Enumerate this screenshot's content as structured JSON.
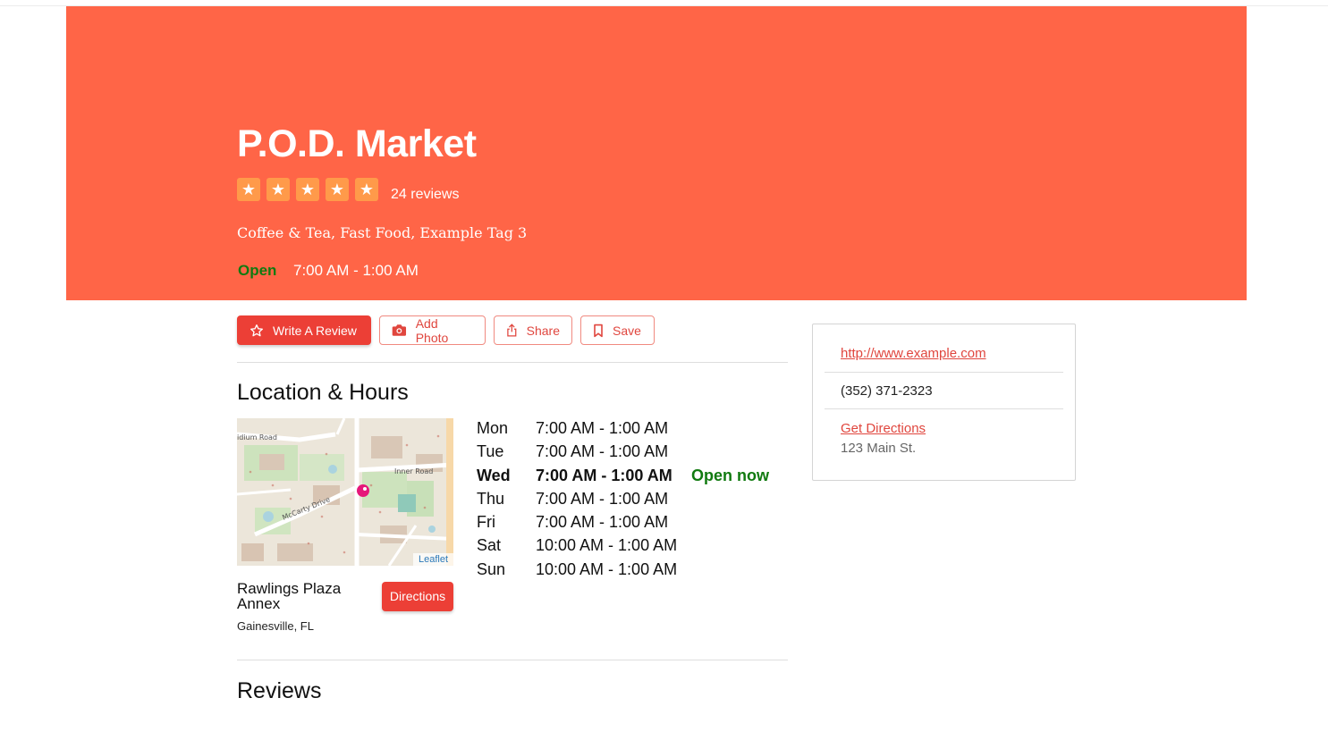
{
  "business": {
    "name": "P.O.D. Market",
    "rating_stars": 5,
    "review_count_text": "24 reviews",
    "tags": "Coffee & Tea, Fast Food, Example Tag 3",
    "open_status": "Open",
    "today_hours": "7:00 AM - 1:00 AM"
  },
  "colors": {
    "hero_bg": "#ff6547",
    "star_bg": "#ff9a4a",
    "accent_red": "#ec3f36",
    "open_green": "#117a10"
  },
  "actions": {
    "write_review": "Write A Review",
    "add_photo": "Add Photo",
    "share": "Share",
    "save": "Save"
  },
  "location": {
    "section_title": "Location & Hours",
    "map_attribution": "Leaflet",
    "map_labels": [
      "idium Road",
      "Inner Road",
      "McCarty Drive"
    ],
    "place_name": "Rawlings Plaza Annex",
    "city": "Gainesville, FL",
    "directions_label": "Directions",
    "hours": [
      {
        "day": "Mon",
        "time": "7:00 AM - 1:00 AM"
      },
      {
        "day": "Tue",
        "time": "7:00 AM - 1:00 AM"
      },
      {
        "day": "Wed",
        "time": "7:00 AM - 1:00 AM",
        "today": true,
        "status": "Open now"
      },
      {
        "day": "Thu",
        "time": "7:00 AM - 1:00 AM"
      },
      {
        "day": "Fri",
        "time": "7:00 AM - 1:00 AM"
      },
      {
        "day": "Sat",
        "time": "10:00 AM - 1:00 AM"
      },
      {
        "day": "Sun",
        "time": "10:00 AM - 1:00 AM"
      }
    ]
  },
  "contact": {
    "website": "http://www.example.com",
    "phone": "(352) 371-2323",
    "get_directions": "Get Directions",
    "address": "123 Main St."
  },
  "reviews": {
    "section_title": "Reviews"
  }
}
